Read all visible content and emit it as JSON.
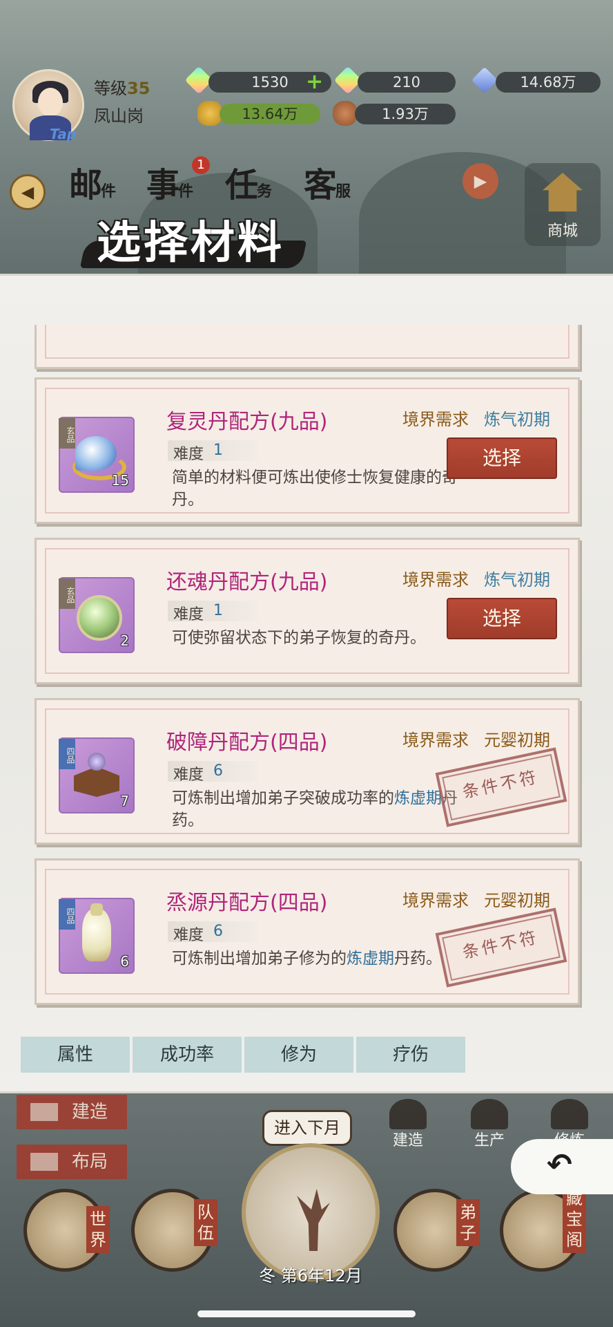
{
  "status_bar": {
    "level_label": "等级",
    "level_value": "35",
    "sect_name": "凤山岗",
    "tap_badge": "Tap",
    "resources": [
      {
        "icon": "rainbow-gem-icon",
        "value": "1530",
        "has_plus": true
      },
      {
        "icon": "rainbow-gem-icon",
        "value": "210"
      },
      {
        "icon": "blue-gem-icon",
        "value": "14.68万"
      },
      {
        "icon": "gold-ore-icon",
        "value": "13.64万"
      },
      {
        "icon": "meat-icon",
        "value": "1.93万"
      }
    ]
  },
  "nav": {
    "tabs": [
      {
        "main": "邮",
        "sub": "件"
      },
      {
        "main": "事",
        "sub": "件",
        "badge": "1"
      },
      {
        "main": "任",
        "sub": "务"
      },
      {
        "main": "客",
        "sub": "服"
      }
    ],
    "shop_label": "商城"
  },
  "dialog": {
    "title": "选择材料",
    "realm_label": "境界需求",
    "difficulty_label": "难度",
    "select_label": "选择",
    "unmet_label": "条件不符",
    "recipes": [
      {
        "name": "复灵丹配方(九品)",
        "grade": "玄品",
        "count": "15",
        "realm": "炼气初期",
        "difficulty": "1",
        "desc": "简单的材料便可炼出使修士恢复健康的奇丹。",
        "selectable": true
      },
      {
        "name": "还魂丹配方(九品)",
        "grade": "玄品",
        "count": "2",
        "realm": "炼气初期",
        "difficulty": "1",
        "desc": "可使弥留状态下的弟子恢复的奇丹。",
        "selectable": true
      },
      {
        "name": "破障丹配方(四品)",
        "grade": "四品",
        "count": "7",
        "realm": "元婴初期",
        "difficulty": "6",
        "desc_pre": "可炼制出增加弟子突破成功率的",
        "desc_hl": "炼虚期",
        "desc_post": "丹药。",
        "selectable": false
      },
      {
        "name": "烝源丹配方(四品)",
        "grade": "四品",
        "count": "6",
        "realm": "元婴初期",
        "difficulty": "6",
        "desc_pre": "可炼制出增加弟子修为的",
        "desc_hl": "炼虚期",
        "desc_post": "丹药。",
        "selectable": false
      }
    ],
    "filter_tabs": [
      "属性",
      "成功率",
      "修为",
      "疗伤"
    ]
  },
  "bottom": {
    "build_label": "建造",
    "layout_label": "布局",
    "next_month": "进入下月",
    "date": "冬 第6年12月",
    "mini_buttons": [
      "建造",
      "生产",
      "修炼"
    ],
    "round_buttons": [
      {
        "label": "世界"
      },
      {
        "label": "队伍"
      },
      {
        "label": "弟子"
      },
      {
        "label": "藏宝阁"
      }
    ]
  },
  "colors": {
    "accent_red": "#a43a2d",
    "recipe_title": "#b0247a",
    "realm_blue": "#3f7fa0",
    "realm_brown": "#8a5a18"
  }
}
